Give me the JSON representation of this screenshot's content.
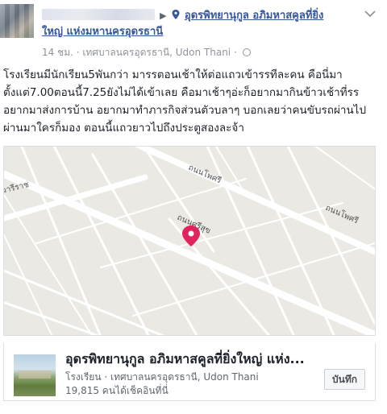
{
  "header": {
    "play_symbol": "▶",
    "place_name_line1": "อุดรพิทยานุกูล อภิมหาสคูลที่ยิ่ง",
    "place_name_line2": "ใหญ่ แห่งมหานครอุดรธานี",
    "meta": "14 ชม. · เทศบาลนครอุดรธานี, Udon Thani ·",
    "place_icon": "map-pin-icon",
    "privacy_icon": "globe-icon",
    "menu_icon": "chevron-down-icon"
  },
  "post": {
    "text": "โรงเรียนมีนักเรียน5พันกว่า มารรตอนเช้าให้ต่อแถวเข้ารรทีละคน คือนี่มาตั้งแต่7.00ตอนนี้7.25ยังไม่ได้เข้าเลย คือมาเช้าๆอ่ะก็อยากมากินข้าวเช้าที่รร อยากมาส่งการบ้าน อยากมาทำภารกิจส่วนตัวบลาๆ บอกเลยว่าคนขับรถผ่านไปผ่านมาใครก็มอง ตอนนี้แถวยาวไปถึงประตูสองละจ้า"
  },
  "map": {
    "labels": {
      "road_top": "ถนนโพศรี",
      "road_right": "ถนนโพศรี",
      "road_center": "ถนนศรีสุข",
      "road_left": "วารีราช"
    },
    "pin_color": "#e0245e"
  },
  "card": {
    "title": "อุดรพิทยานุกูล อภิมหาสคูลที่ยิ่งใหญ่ แห่ง...",
    "subtitle": "โรงเรียน · เทศบาลนครอุดรธานี, Udon Thani",
    "likes": "19,815 คนได้เช็คอินที่นี่",
    "save_label": "บันทึก"
  },
  "colors": {
    "link": "#365899",
    "text": "#1d2129",
    "muted": "#90949c",
    "map_bg": "#ebe9e4"
  }
}
